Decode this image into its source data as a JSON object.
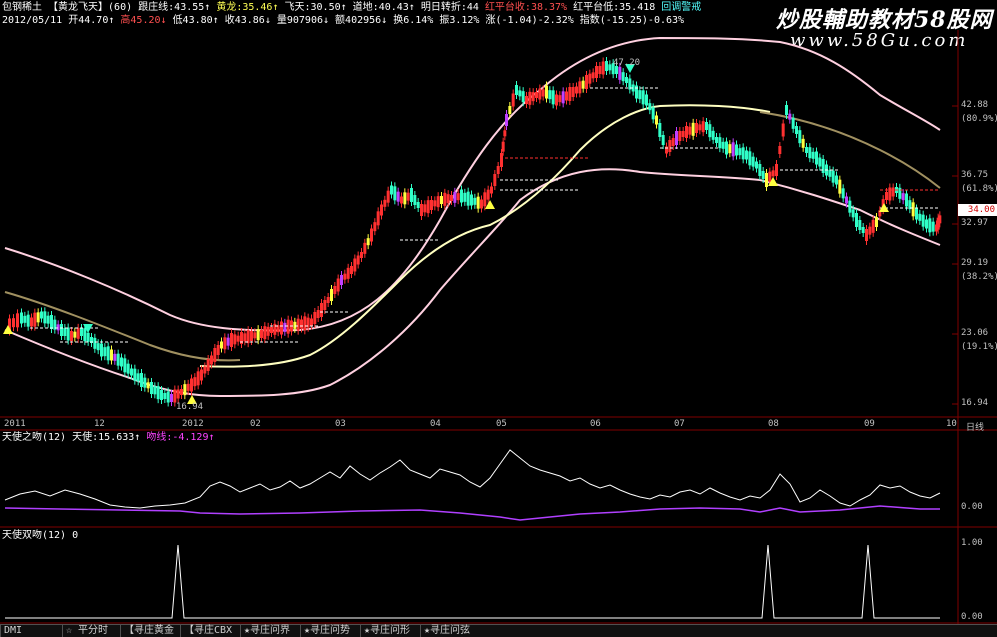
{
  "header": {
    "line1": {
      "stock_name": "包钢稀土",
      "indicator_name": "【黄龙飞天】",
      "period": "(60)",
      "items": [
        {
          "label": "跟庄线:43.55↑",
          "color": "#ffffff"
        },
        {
          "label": "黄龙:35.46↑",
          "color": "#ffff55"
        },
        {
          "label": "飞天:30.50↑",
          "color": "#ffffff"
        },
        {
          "label": "道地:40.43↑",
          "color": "#ffffff"
        },
        {
          "label": "明日转折:44",
          "color": "#ffffff"
        },
        {
          "label": "红平台收:38.37%",
          "color": "#ff5050"
        },
        {
          "label": "红平台低:35.418",
          "color": "#ffffff"
        },
        {
          "label": "回调警戒",
          "color": "#55ffff"
        }
      ]
    },
    "line2": {
      "date": "2012/05/11",
      "items": [
        {
          "label": "开44.70↑",
          "color": "#ffffff"
        },
        {
          "label": "高45.20↓",
          "color": "#ff5050"
        },
        {
          "label": "低43.80↑",
          "color": "#ffffff"
        },
        {
          "label": "收43.86↓",
          "color": "#ffffff"
        },
        {
          "label": "量907906↓",
          "color": "#ffffff"
        },
        {
          "label": "额402956↓",
          "color": "#ffffff"
        },
        {
          "label": "换6.14%",
          "color": "#ffffff"
        },
        {
          "label": "振3.12%",
          "color": "#ffffff"
        },
        {
          "label": "涨(-1.04)-2.32%",
          "color": "#ffffff"
        },
        {
          "label": "指数(-15.25)-0.63%",
          "color": "#ffffff"
        }
      ]
    }
  },
  "watermark": {
    "title": "炒股輔助教材58股网",
    "url": "www.58Gu.com"
  },
  "price_panel": {
    "y_ticks": [
      "42.88",
      "(80.9%)",
      "36.75",
      "(61.8%)",
      "32.97",
      "29.19",
      "(38.2%)",
      "23.06",
      "(19.1%)",
      "16.94"
    ],
    "current_price": "34.00",
    "peak_label": "47.20",
    "trough_label": "16.94"
  },
  "x_axis": {
    "labels": [
      "2011",
      "12",
      "2012",
      "02",
      "03",
      "04",
      "05",
      "06",
      "07",
      "08",
      "09",
      "10"
    ],
    "period_label": "日线"
  },
  "panel2": {
    "title": "天使之吻(12)",
    "value1": "天使:15.633↑",
    "value2": "吻线:-4.129↑",
    "y_ticks": [
      "0.00"
    ]
  },
  "panel3": {
    "title": "天使双吻(12)",
    "value": "0",
    "y_ticks": [
      "1.00",
      "0.00"
    ]
  },
  "tabs": [
    {
      "label": "DMI"
    },
    {
      "label": "☆ 平分时"
    },
    {
      "label": "【寻庄黄金"
    },
    {
      "label": "【寻庄CBX"
    },
    {
      "label": "★寻庄问界"
    },
    {
      "label": "★寻庄问势"
    },
    {
      "label": "★寻庄问形"
    },
    {
      "label": "★寻庄问弦"
    }
  ],
  "colors": {
    "background": "#000000",
    "up_candle": "#ff3030",
    "down_candle": "#30ffc8",
    "yellow_candle": "#ffff40",
    "magenta_candle": "#c040ff",
    "band_outer": "#ffd8e8",
    "band_inner": "#ffffc0",
    "ma_line": "#a09060",
    "panel_border": "#800000"
  },
  "chart_data": [
    {
      "type": "candlestick",
      "title": "包钢稀土 日线",
      "x_labels": [
        "2011",
        "12",
        "2012",
        "02",
        "03",
        "04",
        "05",
        "06",
        "07",
        "08",
        "09",
        "10"
      ],
      "series": [
        {
          "name": "close",
          "approx_values": [
            22.5,
            21.0,
            18.5,
            16.94,
            20.5,
            23.0,
            23.5,
            24.0,
            27.0,
            31.0,
            35.5,
            34.5,
            36.0,
            44.5,
            45.5,
            44.0,
            47.2,
            46.0,
            40.5,
            38.5,
            41.0,
            37.5,
            41.5,
            37.0,
            34.0,
            32.5,
            35.0,
            32.97,
            34.0
          ]
        }
      ],
      "y_range": [
        16.94,
        47.2
      ]
    },
    {
      "type": "line",
      "title": "天使之吻(12)",
      "series": [
        {
          "name": "天使",
          "last": 15.633
        },
        {
          "name": "吻线",
          "last": -4.129
        }
      ]
    },
    {
      "type": "line",
      "title": "天使双吻(12)",
      "series": [
        {
          "name": "天使双吻",
          "spike_positions_month": [
            "12",
            "08",
            "09"
          ],
          "values": [
            0,
            1,
            0
          ]
        }
      ],
      "y_range": [
        0,
        1
      ]
    }
  ]
}
